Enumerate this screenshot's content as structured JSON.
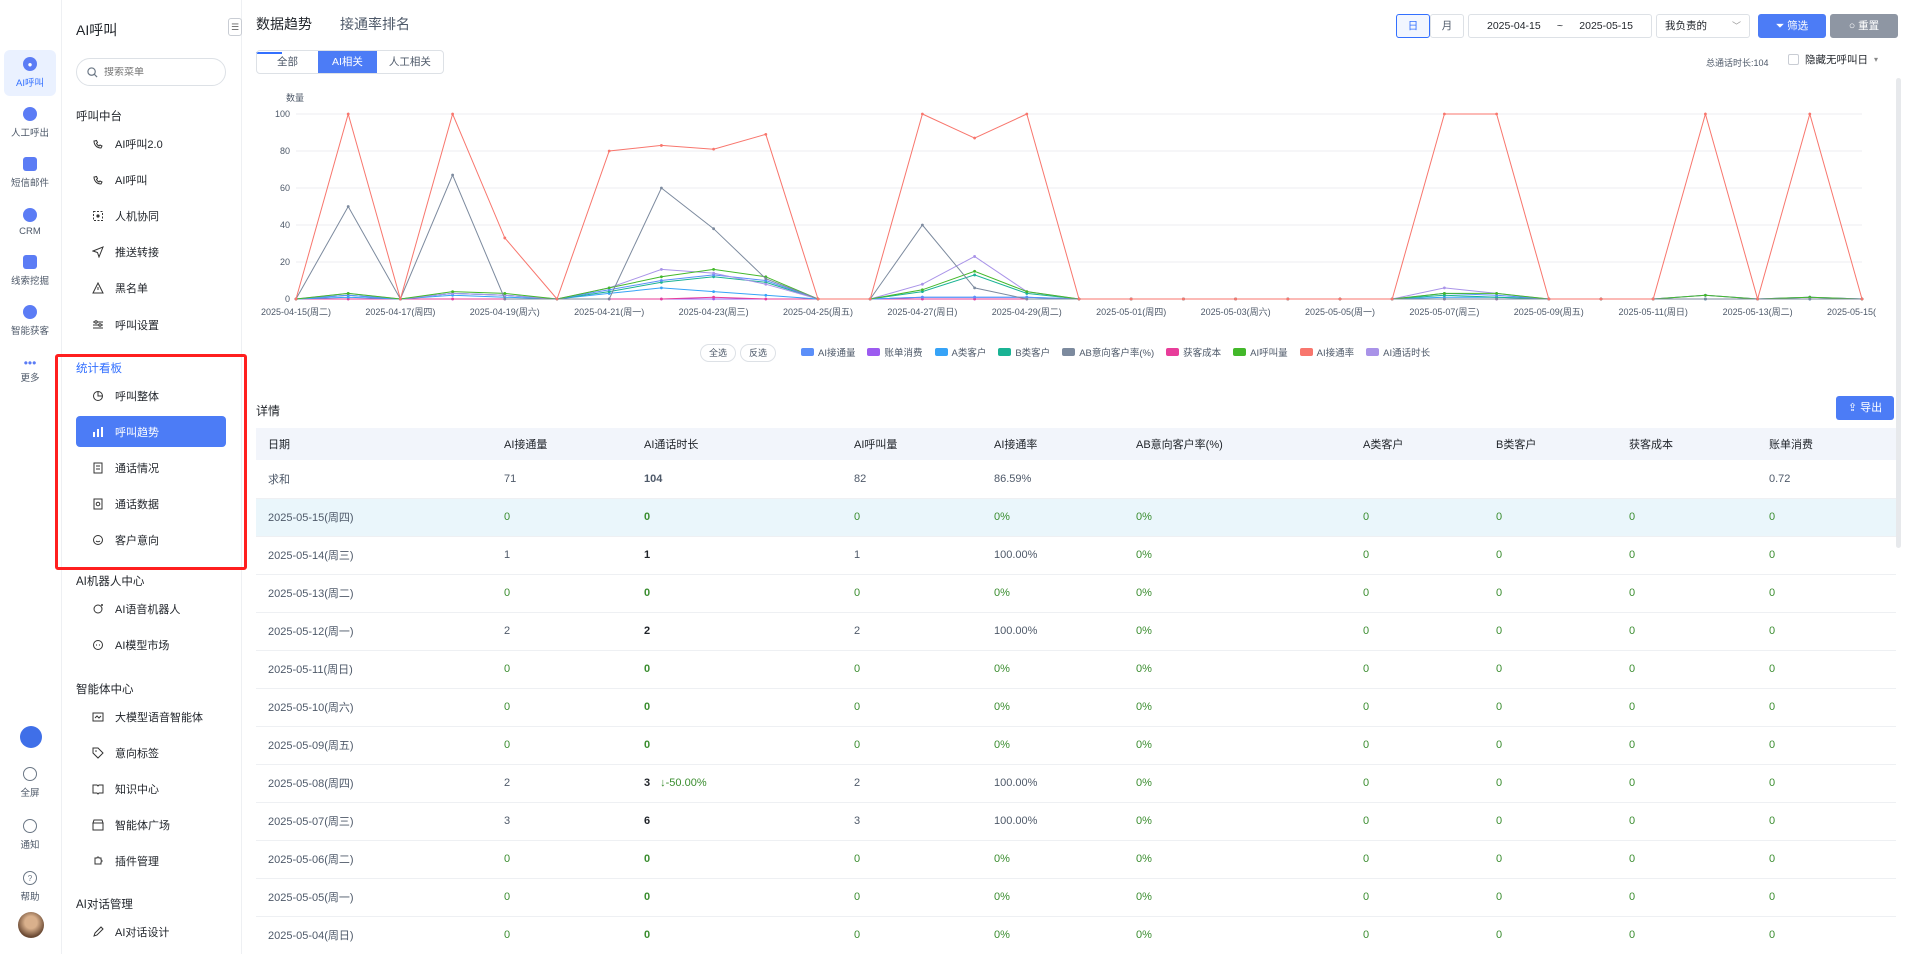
{
  "rail": {
    "items": [
      {
        "label": "AI呼叫",
        "icon": "ai-call-icon"
      },
      {
        "label": "人工呼出",
        "icon": "manual-call-icon"
      },
      {
        "label": "短信邮件",
        "icon": "sms-email-icon"
      },
      {
        "label": "CRM",
        "icon": "crm-icon"
      },
      {
        "label": "线索挖掘",
        "icon": "lead-mining-icon"
      },
      {
        "label": "智能获客",
        "icon": "smart-acquire-icon"
      },
      {
        "label": "更多",
        "icon": "more-icon"
      },
      {
        "label": "全屏",
        "icon": "fullscreen-icon"
      },
      {
        "label": "通知",
        "icon": "bell-icon"
      },
      {
        "label": "帮助",
        "icon": "help-icon"
      }
    ]
  },
  "sidebar": {
    "title": "AI呼叫",
    "search_placeholder": "搜索菜单",
    "groups": [
      {
        "label": "呼叫中台",
        "items": [
          "AI呼叫2.0",
          "AI呼叫",
          "人机协同",
          "推送转接",
          "黑名单",
          "呼叫设置"
        ]
      },
      {
        "label": "统计看板",
        "items": [
          "呼叫整体",
          "呼叫趋势",
          "通话情况",
          "通话数据",
          "客户意向"
        ]
      },
      {
        "label": "AI机器人中心",
        "items": [
          "AI语音机器人",
          "AI模型市场"
        ]
      },
      {
        "label": "智能体中心",
        "items": [
          "大模型语音智能体",
          "意向标签",
          "知识中心",
          "智能体广场",
          "插件管理"
        ]
      },
      {
        "label": "AI对话管理",
        "items": [
          "AI对话设计"
        ]
      }
    ]
  },
  "header": {
    "tabs": [
      "数据趋势",
      "接通率排名"
    ],
    "segments": [
      "全部",
      "AI相关",
      "人工相关"
    ],
    "day": "日",
    "month": "月",
    "date_start": "2025-04-15",
    "date_sep": "~",
    "date_end": "2025-05-15",
    "owner_select": "我负责的",
    "filter": "筛选",
    "reset": "重置",
    "total_duration": "总通话时长:104",
    "hide_no_call": "隐藏无呼叫日"
  },
  "chart_data": {
    "type": "line",
    "ylabel": "数量",
    "ylim": [
      0,
      100
    ],
    "y_ticks": [
      0,
      20,
      40,
      60,
      80,
      100
    ],
    "x": [
      "2025-04-15(周二)",
      "2025-04-16(周三)",
      "2025-04-17(周四)",
      "2025-04-18(周五)",
      "2025-04-19(周六)",
      "2025-04-20(周日)",
      "2025-04-21(周一)",
      "2025-04-22(周二)",
      "2025-04-23(周三)",
      "2025-04-24(周四)",
      "2025-04-25(周五)",
      "2025-04-26(周六)",
      "2025-04-27(周日)",
      "2025-04-28(周一)",
      "2025-04-29(周二)",
      "2025-04-30(周三)",
      "2025-05-01(周四)",
      "2025-05-02(周五)",
      "2025-05-03(周六)",
      "2025-05-04(周日)",
      "2025-05-05(周一)",
      "2025-05-06(周二)",
      "2025-05-07(周三)",
      "2025-05-08(周四)",
      "2025-05-09(周五)",
      "2025-05-10(周六)",
      "2025-05-11(周日)",
      "2025-05-12(周一)",
      "2025-05-13(周二)",
      "2025-05-14(周三)",
      "2025-05-15(周四)"
    ],
    "x_tick_labels": [
      "2025-04-15(周二)",
      "2025-04-17(周四)",
      "2025-04-19(周六)",
      "2025-04-21(周一)",
      "2025-04-23(周三)",
      "2025-04-25(周五)",
      "2025-04-27(周日)",
      "2025-04-29(周二)",
      "2025-05-01(周四)",
      "2025-05-03(周六)",
      "2025-05-05(周一)",
      "2025-05-07(周三)",
      "2025-05-09(周五)",
      "2025-05-11(周日)",
      "2025-05-13(周二)",
      "2025-05-15(周四)"
    ],
    "series": [
      {
        "name": "AI接通量",
        "color": "#5b8ff9",
        "values": [
          0,
          2,
          0,
          3,
          2,
          0,
          5,
          10,
          13,
          10,
          0,
          0,
          1,
          1,
          1,
          0,
          0,
          0,
          0,
          0,
          0,
          0,
          3,
          2,
          0,
          0,
          0,
          2,
          0,
          1,
          0
        ]
      },
      {
        "name": "账单消费",
        "color": "#9c5bf0",
        "values": [
          0,
          0,
          0,
          0,
          0,
          0,
          0,
          0,
          0,
          0,
          0,
          0,
          0,
          0,
          0,
          0,
          0,
          0,
          0,
          0,
          0,
          0,
          0,
          0,
          0,
          0,
          0,
          0,
          0,
          0,
          0
        ]
      },
      {
        "name": "A类客户",
        "color": "#36a3f7",
        "values": [
          0,
          1,
          0,
          2,
          1,
          0,
          3,
          6,
          4,
          2,
          0,
          0,
          1,
          1,
          1,
          0,
          0,
          0,
          0,
          0,
          0,
          0,
          1,
          1,
          0,
          0,
          0,
          0,
          0,
          0,
          0
        ]
      },
      {
        "name": "B类客户",
        "color": "#1ab394",
        "values": [
          0,
          2,
          0,
          3,
          2,
          0,
          4,
          9,
          12,
          9,
          0,
          0,
          4,
          13,
          3,
          0,
          0,
          0,
          0,
          0,
          0,
          0,
          2,
          1,
          0,
          0,
          0,
          0,
          0,
          0,
          0
        ]
      },
      {
        "name": "AB意向客户率(%)",
        "color": "#7c8a9e",
        "values": [
          0,
          50,
          0,
          67,
          0,
          0,
          0,
          60,
          38,
          11,
          0,
          0,
          40,
          6,
          0,
          0,
          0,
          0,
          0,
          0,
          0,
          0,
          0,
          0,
          0,
          0,
          0,
          0,
          0,
          0,
          0
        ]
      },
      {
        "name": "获客成本",
        "color": "#e83d9a",
        "values": [
          0,
          0,
          0,
          0,
          0,
          0,
          0,
          0,
          1,
          0,
          0,
          0,
          0,
          0,
          0,
          0,
          0,
          0,
          0,
          0,
          0,
          0,
          0,
          0,
          0,
          0,
          0,
          0,
          0,
          0,
          0
        ]
      },
      {
        "name": "AI呼叫量",
        "color": "#43b82a",
        "values": [
          0,
          3,
          0,
          4,
          3,
          0,
          6,
          12,
          16,
          12,
          0,
          0,
          5,
          15,
          4,
          0,
          0,
          0,
          0,
          0,
          0,
          0,
          3,
          3,
          0,
          0,
          0,
          2,
          0,
          1,
          0
        ]
      },
      {
        "name": "AI接通率",
        "color": "#f8766d",
        "values": [
          0,
          100,
          0,
          100,
          33,
          0,
          80,
          83,
          81,
          89,
          0,
          0,
          100,
          87,
          100,
          0,
          0,
          0,
          0,
          0,
          0,
          0,
          100,
          100,
          0,
          0,
          0,
          100,
          0,
          100,
          0
        ]
      },
      {
        "name": "AI通话时长",
        "color": "#a993e8",
        "values": [
          0,
          3,
          0,
          3,
          2,
          0,
          6,
          16,
          14,
          8,
          0,
          0,
          8,
          23,
          4,
          0,
          0,
          0,
          0,
          0,
          0,
          0,
          6,
          3,
          0,
          0,
          0,
          2,
          0,
          1,
          0
        ]
      }
    ]
  },
  "legend_controls": {
    "select_all": "全选",
    "invert": "反选"
  },
  "detail": {
    "title": "详情",
    "export": "导出",
    "columns": [
      "日期",
      "AI接通量",
      "AI通话时长",
      "AI呼叫量",
      "AI接通率",
      "AB意向客户率(%)",
      "A类客户",
      "B类客户",
      "获客成本",
      "账单消费"
    ],
    "sum_row": [
      "求和",
      "71",
      "104",
      "82",
      "86.59%",
      "",
      "",
      "",
      "",
      "0.72"
    ],
    "rows": [
      {
        "cells": [
          "2025-05-15(周四)",
          "0",
          "0",
          "0",
          "0%",
          "0%",
          "0",
          "0",
          "0",
          "0"
        ],
        "delta": ""
      },
      {
        "cells": [
          "2025-05-14(周三)",
          "1",
          "1",
          "1",
          "100.00%",
          "0%",
          "0",
          "0",
          "0",
          "0"
        ],
        "delta": ""
      },
      {
        "cells": [
          "2025-05-13(周二)",
          "0",
          "0",
          "0",
          "0%",
          "0%",
          "0",
          "0",
          "0",
          "0"
        ],
        "delta": ""
      },
      {
        "cells": [
          "2025-05-12(周一)",
          "2",
          "2",
          "2",
          "100.00%",
          "0%",
          "0",
          "0",
          "0",
          "0"
        ],
        "delta": ""
      },
      {
        "cells": [
          "2025-05-11(周日)",
          "0",
          "0",
          "0",
          "0%",
          "0%",
          "0",
          "0",
          "0",
          "0"
        ],
        "delta": ""
      },
      {
        "cells": [
          "2025-05-10(周六)",
          "0",
          "0",
          "0",
          "0%",
          "0%",
          "0",
          "0",
          "0",
          "0"
        ],
        "delta": ""
      },
      {
        "cells": [
          "2025-05-09(周五)",
          "0",
          "0",
          "0",
          "0%",
          "0%",
          "0",
          "0",
          "0",
          "0"
        ],
        "delta": ""
      },
      {
        "cells": [
          "2025-05-08(周四)",
          "2",
          "3",
          "2",
          "100.00%",
          "0%",
          "0",
          "0",
          "0",
          "0"
        ],
        "delta": "↓-50.00%"
      },
      {
        "cells": [
          "2025-05-07(周三)",
          "3",
          "6",
          "3",
          "100.00%",
          "0%",
          "0",
          "0",
          "0",
          "0"
        ],
        "delta": ""
      },
      {
        "cells": [
          "2025-05-06(周二)",
          "0",
          "0",
          "0",
          "0%",
          "0%",
          "0",
          "0",
          "0",
          "0"
        ],
        "delta": ""
      },
      {
        "cells": [
          "2025-05-05(周一)",
          "0",
          "0",
          "0",
          "0%",
          "0%",
          "0",
          "0",
          "0",
          "0"
        ],
        "delta": ""
      },
      {
        "cells": [
          "2025-05-04(周日)",
          "0",
          "0",
          "0",
          "0%",
          "0%",
          "0",
          "0",
          "0",
          "0"
        ],
        "delta": ""
      }
    ]
  },
  "colors": {
    "accent": "#4c7cf6",
    "highlight_box": "#ff1f1f",
    "positive": "#3a8d2f"
  }
}
